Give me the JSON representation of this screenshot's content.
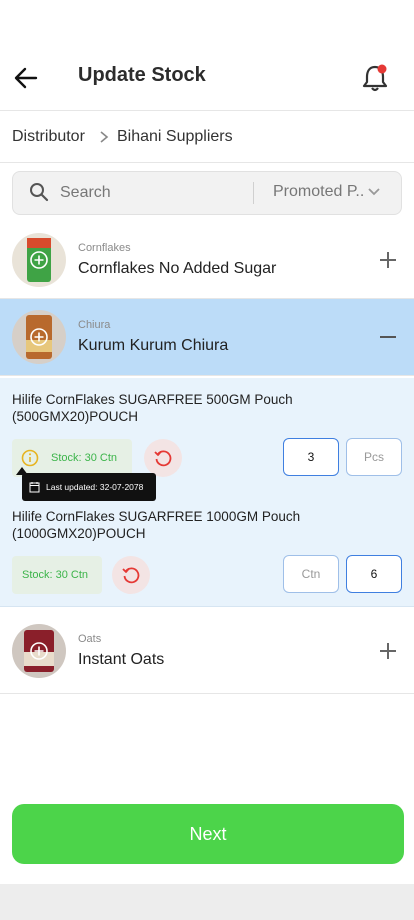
{
  "header": {
    "title": "Update Stock"
  },
  "breadcrumb": {
    "root": "Distributor",
    "current": "Bihani Suppliers"
  },
  "search": {
    "placeholder": "Search",
    "filter_value": "Promoted P.."
  },
  "categories": [
    {
      "category": "Cornflakes",
      "name": "Cornflakes No Added Sugar",
      "expanded": false
    },
    {
      "category": "Chiura",
      "name": "Kurum Kurum Chiura",
      "expanded": true
    },
    {
      "category": "Oats",
      "name": "Instant Oats",
      "expanded": false
    }
  ],
  "products": [
    {
      "name_line1": "Hilife CornFlakes SUGARFREE 500GM Pouch",
      "name_line2": "(500GMX20)POUCH",
      "stock": "Stock: 30 Ctn",
      "qty_left": "3",
      "qty_right": "Pcs"
    },
    {
      "name_line1": "Hilife CornFlakes SUGARFREE 1000GM Pouch",
      "name_line2": "(1000GMX20)POUCH",
      "stock": "Stock: 30 Ctn",
      "qty_left": "Ctn",
      "qty_right": "6"
    }
  ],
  "tooltip": {
    "text": "Last updated: 32-07-2078"
  },
  "next_button": {
    "label": "Next"
  },
  "colors": {
    "accent_green": "#4cd44a",
    "active_row": "#bcdcf8",
    "notification_dot": "#e53935",
    "stock_green": "#3cb44a"
  }
}
